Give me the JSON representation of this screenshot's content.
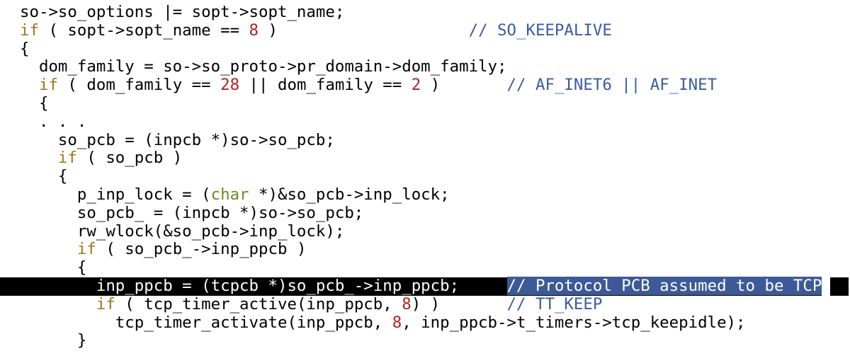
{
  "colors": {
    "background": "#ffffff",
    "text": "#000000",
    "keyword": "#a0761a",
    "type_keyword": "#6b8e23",
    "number": "#b22222",
    "comment": "#3b5ba5",
    "highlight_line": "#000000",
    "selection": "#3d5a98"
  },
  "code_lines": [
    {
      "segments": [
        {
          "t": "so->so_options |= sopt->sopt_name;",
          "c": ""
        }
      ]
    },
    {
      "segments": [
        {
          "t": "if",
          "c": "kw"
        },
        {
          "t": " ( sopt->sopt_name == ",
          "c": ""
        },
        {
          "t": "8",
          "c": "num"
        },
        {
          "t": " )                    ",
          "c": ""
        },
        {
          "t": "// SO_KEEPALIVE",
          "c": "cmt"
        }
      ]
    },
    {
      "segments": [
        {
          "t": "{",
          "c": ""
        }
      ]
    },
    {
      "segments": [
        {
          "t": "  dom_family = so->so_proto->pr_domain->dom_family;",
          "c": ""
        }
      ]
    },
    {
      "segments": [
        {
          "t": "  ",
          "c": ""
        },
        {
          "t": "if",
          "c": "kw"
        },
        {
          "t": " ( dom_family == ",
          "c": ""
        },
        {
          "t": "28",
          "c": "num"
        },
        {
          "t": " || dom_family == ",
          "c": ""
        },
        {
          "t": "2",
          "c": "num"
        },
        {
          "t": " )       ",
          "c": ""
        },
        {
          "t": "// AF_INET6 || AF_INET",
          "c": "cmt"
        }
      ]
    },
    {
      "segments": [
        {
          "t": "  {",
          "c": ""
        }
      ]
    },
    {
      "segments": [
        {
          "t": "  . . .",
          "c": ""
        }
      ]
    },
    {
      "segments": [
        {
          "t": "    so_pcb = (inpcb *)so->so_pcb;",
          "c": ""
        }
      ]
    },
    {
      "segments": [
        {
          "t": "    ",
          "c": ""
        },
        {
          "t": "if",
          "c": "kw"
        },
        {
          "t": " ( so_pcb )",
          "c": ""
        }
      ]
    },
    {
      "segments": [
        {
          "t": "    {",
          "c": ""
        }
      ]
    },
    {
      "segments": [
        {
          "t": "      p_inp_lock = (",
          "c": ""
        },
        {
          "t": "char",
          "c": "kw-green"
        },
        {
          "t": " *)&so_pcb->inp_lock;",
          "c": ""
        }
      ]
    },
    {
      "segments": [
        {
          "t": "      so_pcb_ = (inpcb *)so->so_pcb;",
          "c": ""
        }
      ]
    },
    {
      "segments": [
        {
          "t": "      rw_wlock(&so_pcb->inp_lock);",
          "c": ""
        }
      ]
    },
    {
      "segments": [
        {
          "t": "      ",
          "c": ""
        },
        {
          "t": "if",
          "c": "kw"
        },
        {
          "t": " ( so_pcb_->inp_ppcb )",
          "c": ""
        }
      ]
    },
    {
      "segments": [
        {
          "t": "      {",
          "c": ""
        }
      ]
    },
    {
      "highlight": true,
      "segments": [
        {
          "t": "        inp_ppcb = (tcpcb *)so_pcb_->inp_ppcb;     ",
          "c": ""
        },
        {
          "t": "// Protocol PCB assumed to be TCP",
          "c": "cmt-sel"
        }
      ]
    },
    {
      "segments": [
        {
          "t": "        ",
          "c": ""
        },
        {
          "t": "if",
          "c": "kw"
        },
        {
          "t": " ( tcp_timer_active(inp_ppcb, ",
          "c": ""
        },
        {
          "t": "8",
          "c": "num"
        },
        {
          "t": ") )       ",
          "c": ""
        },
        {
          "t": "// TT_KEEP",
          "c": "cmt"
        }
      ]
    },
    {
      "segments": [
        {
          "t": "          tcp_timer_activate(inp_ppcb, ",
          "c": ""
        },
        {
          "t": "8",
          "c": "num"
        },
        {
          "t": ", inp_ppcb->t_timers->tcp_keepidle);",
          "c": ""
        }
      ]
    },
    {
      "segments": [
        {
          "t": "      }",
          "c": ""
        }
      ]
    }
  ]
}
